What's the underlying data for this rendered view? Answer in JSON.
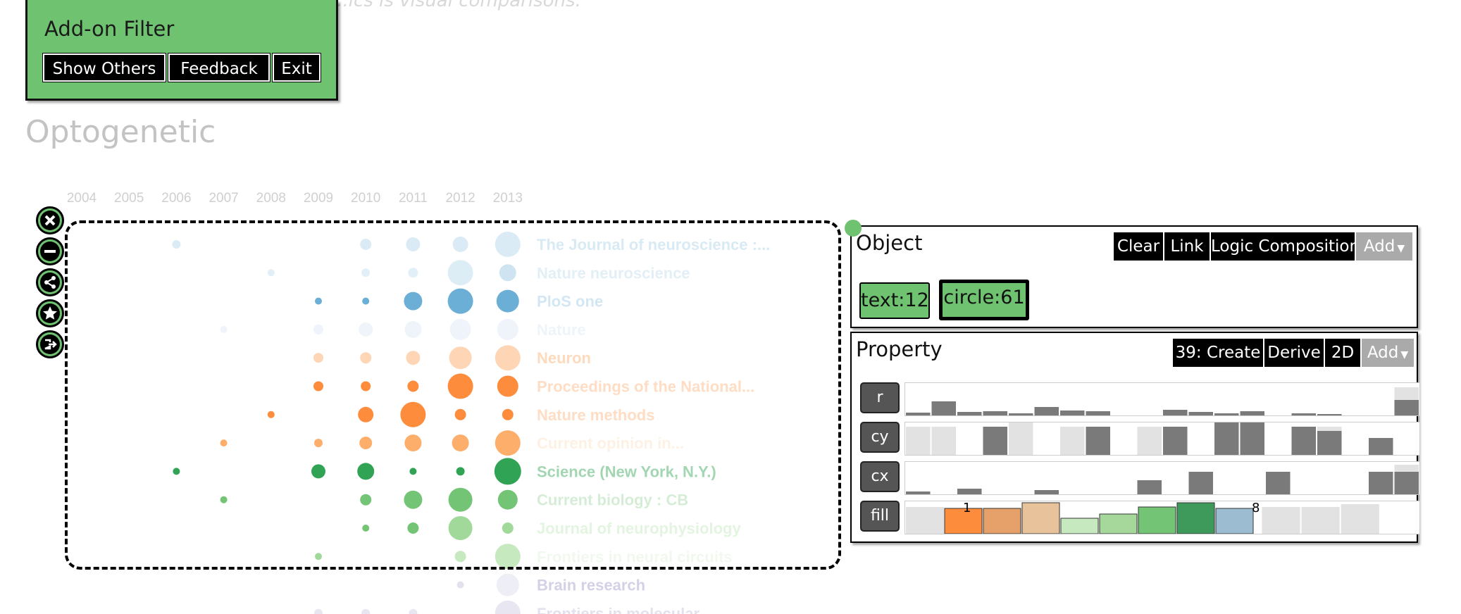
{
  "caption": "...ics is visual comparisons.",
  "filter_panel": {
    "title": "Add-on Filter",
    "buttons": [
      "Show Others",
      "Feedback",
      "Exit"
    ]
  },
  "page_title": "Optogenetic",
  "years": [
    "2004",
    "2005",
    "2006",
    "2007",
    "2008",
    "2009",
    "2010",
    "2011",
    "2012",
    "2013"
  ],
  "journals": [
    {
      "name": "The Journal of neuroscience :...",
      "color": "#9ecae1",
      "opacity": 0.4
    },
    {
      "name": "Nature neuroscience",
      "color": "#9ecae1",
      "opacity": 0.3
    },
    {
      "name": "PloS one",
      "color": "#6baed6",
      "opacity": 0.3
    },
    {
      "name": "Nature",
      "color": "#c6dbef",
      "opacity": 0.3
    },
    {
      "name": "Neuron",
      "color": "#fdae6b",
      "opacity": 0.45
    },
    {
      "name": "Proceedings of the National...",
      "color": "#fd8d3c",
      "opacity": 0.3
    },
    {
      "name": "Nature methods",
      "color": "#fd8d3c",
      "opacity": 0.3
    },
    {
      "name": "Current opinion in...",
      "color": "#fdd0a2",
      "opacity": 0.3
    },
    {
      "name": "Science (New York, N.Y.)",
      "color": "#31a354",
      "opacity": 0.45
    },
    {
      "name": "Current biology : CB",
      "color": "#74c476",
      "opacity": 0.3
    },
    {
      "name": "Journal of neurophysiology",
      "color": "#a1d99b",
      "opacity": 0.3
    },
    {
      "name": "Frontiers in neural circuits",
      "color": "#c7e9c0",
      "opacity": 0.25
    },
    {
      "name": "Brain research",
      "color": "#9e9ac8",
      "opacity": 0.45
    },
    {
      "name": "Frontiers in molecular...",
      "color": "#9e9ac8",
      "opacity": 0.3
    }
  ],
  "bubbles": [
    [
      0,
      2,
      3,
      "#6baed6",
      0.25
    ],
    [
      0,
      6,
      4,
      "#6baed6",
      0.25
    ],
    [
      0,
      7,
      5,
      "#6baed6",
      0.25
    ],
    [
      0,
      8,
      5.5,
      "#6baed6",
      0.25
    ],
    [
      0,
      9,
      9,
      "#6baed6",
      0.25
    ],
    [
      1,
      4,
      2.5,
      "#6baed6",
      0.2
    ],
    [
      1,
      6,
      3,
      "#6baed6",
      0.2
    ],
    [
      1,
      7,
      3.5,
      "#6baed6",
      0.2
    ],
    [
      1,
      8,
      9,
      "#9ecae1",
      0.35
    ],
    [
      1,
      9,
      6,
      "#9ecae1",
      0.5
    ],
    [
      2,
      5,
      2.5,
      "#6baed6",
      1
    ],
    [
      2,
      6,
      2.5,
      "#6baed6",
      1
    ],
    [
      2,
      7,
      6.5,
      "#6baed6",
      1
    ],
    [
      2,
      8,
      9,
      "#6baed6",
      1
    ],
    [
      2,
      9,
      8,
      "#6baed6",
      1
    ],
    [
      3,
      3,
      2.5,
      "#c6dbef",
      0.3
    ],
    [
      3,
      5,
      3.5,
      "#c6dbef",
      0.3
    ],
    [
      3,
      6,
      5,
      "#c6dbef",
      0.3
    ],
    [
      3,
      7,
      6,
      "#c6dbef",
      0.3
    ],
    [
      3,
      8,
      7.5,
      "#c6dbef",
      0.3
    ],
    [
      3,
      9,
      7.5,
      "#c6dbef",
      0.3
    ],
    [
      4,
      5,
      3.5,
      "#fdae6b",
      0.5
    ],
    [
      4,
      6,
      4,
      "#fdae6b",
      0.5
    ],
    [
      4,
      7,
      5,
      "#fdae6b",
      0.5
    ],
    [
      4,
      8,
      8,
      "#fdae6b",
      0.5
    ],
    [
      4,
      9,
      9,
      "#fdae6b",
      0.5
    ],
    [
      5,
      5,
      3.5,
      "#fd8d3c",
      1
    ],
    [
      5,
      6,
      3.5,
      "#fd8d3c",
      1
    ],
    [
      5,
      7,
      4,
      "#fd8d3c",
      1
    ],
    [
      5,
      8,
      9,
      "#fd8d3c",
      1
    ],
    [
      5,
      9,
      7.5,
      "#fd8d3c",
      1
    ],
    [
      6,
      4,
      2.5,
      "#fd8d3c",
      1
    ],
    [
      6,
      6,
      5.5,
      "#fd8d3c",
      1
    ],
    [
      6,
      7,
      9,
      "#fd8d3c",
      1
    ],
    [
      6,
      8,
      4,
      "#fd8d3c",
      1
    ],
    [
      6,
      9,
      4,
      "#fd8d3c",
      1
    ],
    [
      7,
      3,
      2.5,
      "#fdae6b",
      1
    ],
    [
      7,
      5,
      3,
      "#fdae6b",
      1
    ],
    [
      7,
      6,
      4.5,
      "#fdae6b",
      1
    ],
    [
      7,
      7,
      6,
      "#fdae6b",
      1
    ],
    [
      7,
      8,
      6,
      "#fdae6b",
      1
    ],
    [
      7,
      9,
      9,
      "#fdae6b",
      1
    ],
    [
      8,
      2,
      2.5,
      "#31a354",
      1
    ],
    [
      8,
      5,
      5,
      "#31a354",
      1
    ],
    [
      8,
      6,
      6,
      "#31a354",
      1
    ],
    [
      8,
      7,
      2.5,
      "#31a354",
      1
    ],
    [
      8,
      8,
      3,
      "#31a354",
      1
    ],
    [
      8,
      9,
      9.5,
      "#31a354",
      1
    ],
    [
      9,
      3,
      2.5,
      "#74c476",
      1
    ],
    [
      9,
      6,
      4,
      "#74c476",
      1
    ],
    [
      9,
      7,
      6.5,
      "#74c476",
      1
    ],
    [
      9,
      8,
      8.5,
      "#74c476",
      1
    ],
    [
      9,
      9,
      7,
      "#74c476",
      1
    ],
    [
      10,
      6,
      2.5,
      "#74c476",
      1
    ],
    [
      10,
      7,
      4,
      "#74c476",
      1
    ],
    [
      10,
      8,
      8.5,
      "#a1d99b",
      1
    ],
    [
      10,
      9,
      4,
      "#a1d99b",
      1
    ],
    [
      11,
      5,
      2.5,
      "#a1d99b",
      1
    ],
    [
      11,
      8,
      4,
      "#c7e9c0",
      1
    ],
    [
      11,
      9,
      9,
      "#c7e9c0",
      1
    ],
    [
      12,
      8,
      2.5,
      "#9e9ac8",
      0.3
    ],
    [
      12,
      9,
      8,
      "#bcbddc",
      0.25
    ],
    [
      13,
      5,
      3,
      "#9e9ac8",
      0.25
    ],
    [
      13,
      6,
      3,
      "#9e9ac8",
      0.25
    ],
    [
      13,
      7,
      3,
      "#9e9ac8",
      0.25
    ],
    [
      13,
      9,
      9,
      "#9e9ac8",
      0.25
    ]
  ],
  "tools": [
    "close-icon",
    "minus-icon",
    "share-icon",
    "star-icon",
    "exit-icon"
  ],
  "object_panel": {
    "title": "Object",
    "buttons": [
      "Clear",
      "Link",
      "Logic Composition",
      "Add"
    ],
    "chips": [
      "text:12",
      "circle:61"
    ]
  },
  "property_panel": {
    "title": "Property",
    "buttons": [
      "39: Create",
      "Derive",
      "2D",
      "Add"
    ],
    "properties": [
      "r",
      "cy",
      "cx",
      "fill"
    ],
    "fill_marker_start": "1",
    "fill_marker_end": "8"
  },
  "hist": {
    "r": {
      "bg": [
        3,
        0,
        0,
        3,
        0,
        3,
        0,
        0,
        0,
        0,
        0,
        0,
        0,
        0,
        0,
        0,
        0,
        0,
        0,
        40
      ],
      "fg": [
        4,
        20,
        5,
        6,
        3,
        12,
        7,
        6,
        0,
        0,
        8,
        5,
        3,
        6,
        0,
        3,
        2,
        0,
        0,
        22
      ]
    },
    "cy": {
      "bg": [
        40,
        40,
        0,
        0,
        48,
        0,
        40,
        0,
        0,
        40,
        0,
        0,
        48,
        0,
        0,
        0,
        40,
        0,
        0,
        0
      ],
      "fg": [
        0,
        0,
        0,
        40,
        0,
        0,
        0,
        40,
        0,
        0,
        40,
        0,
        48,
        48,
        0,
        40,
        34,
        0,
        24,
        0
      ]
    },
    "cx": {
      "bg": [
        0,
        0,
        0,
        0,
        0,
        0,
        0,
        0,
        0,
        0,
        0,
        0,
        0,
        0,
        0,
        0,
        0,
        0,
        0,
        42
      ],
      "fg": [
        4,
        0,
        8,
        0,
        0,
        6,
        0,
        0,
        0,
        20,
        0,
        32,
        0,
        0,
        32,
        0,
        0,
        0,
        32,
        32
      ]
    },
    "fill_colors": [
      "#fd8d3c",
      "#e6a06a",
      "#e8c29a",
      "#c7e9c0",
      "#a6d79b",
      "#74c476",
      "#3d9a5b",
      "#9cbcd2"
    ],
    "fill_values": [
      36,
      36,
      44,
      22,
      28,
      38,
      44,
      36
    ],
    "fill_bg": [
      38,
      0,
      0,
      0,
      0,
      0,
      0,
      0,
      0,
      38,
      38,
      42,
      0
    ]
  }
}
